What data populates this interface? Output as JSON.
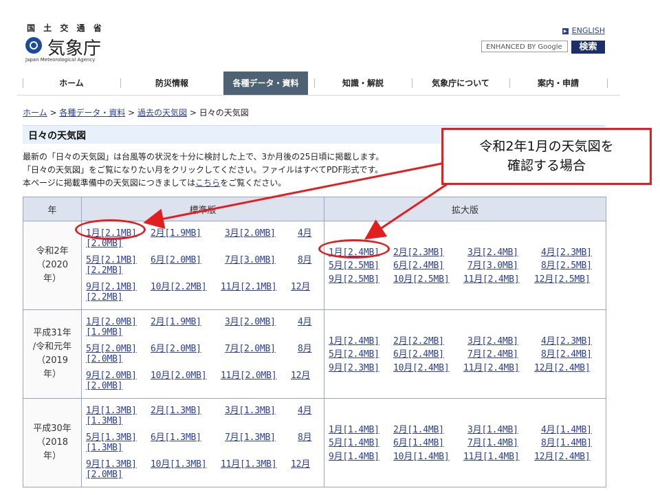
{
  "header": {
    "ministry": "国 土 交 通 省",
    "agency": "気象庁",
    "agency_en": "Japan Meteorological Agency",
    "english_link": "ENGLISH",
    "search_placeholder": "ENHANCED BY Google",
    "search_button": "検索"
  },
  "nav": [
    "ホーム",
    "防災情報",
    "各種データ・資料",
    "知識・解説",
    "気象庁について",
    "案内・申請"
  ],
  "breadcrumb": [
    "ホーム",
    "各種データ・資料",
    "過去の天気図",
    "日々の天気図"
  ],
  "page_title": "日々の天気図",
  "intro": [
    "最新の「日々の天気図」は台風等の状況を十分に検討した上で、3か月後の25日頃に掲載します。",
    "「日々の天気図」をご覧になりたい月をクリックしてください。ファイルはすべてPDF形式です。",
    "本ページに掲載準備中の天気図につきましては",
    "こちら",
    "をご覧ください。"
  ],
  "table": {
    "headers": [
      "年",
      "標準版",
      "拡大版"
    ],
    "rows": [
      {
        "year": [
          "令和2年",
          "（2020",
          "年）"
        ],
        "std": [
          "1月[2.1MB]",
          "2月[1.9MB]",
          "3月[2.0MB]",
          "4月",
          "[2.0MB]",
          "5月[2.1MB]",
          "6月[2.0MB]",
          "7月[3.0MB]",
          "8月",
          "[2.2MB]",
          "9月[2.1MB]",
          "10月[2.2MB]",
          "11月[2.1MB]",
          "12月",
          "[2.2MB]"
        ],
        "ext": [
          "1月[2.4MB]",
          "2月[2.3MB]",
          "3月[2.4MB]",
          "4月[2.3MB]",
          "5月[2.5MB]",
          "6月[2.4MB]",
          "7月[3.0MB]",
          "8月[2.5MB]",
          "9月[2.5MB]",
          "10月[2.5MB]",
          "11月[2.4MB]",
          "12月[2.5MB]"
        ]
      },
      {
        "year": [
          "平成31年",
          "/令和元年",
          "（2019",
          "年）"
        ],
        "std": [
          "1月[2.0MB]",
          "2月[1.9MB]",
          "3月[2.0MB]",
          "4月",
          "[1.9MB]",
          "5月[2.0MB]",
          "6月[2.0MB]",
          "7月[2.0MB]",
          "8月",
          "[2.0MB]",
          "9月[2.0MB]",
          "10月[2.0MB]",
          "11月[2.0MB]",
          "12月",
          "[2.0MB]"
        ],
        "ext": [
          "1月[2.4MB]",
          "2月[2.2MB]",
          "3月[2.4MB]",
          "4月[2.3MB]",
          "5月[2.4MB]",
          "6月[2.4MB]",
          "7月[2.4MB]",
          "8月[2.4MB]",
          "9月[2.3MB]",
          "10月[2.4MB]",
          "11月[2.4MB]",
          "12月[2.4MB]"
        ]
      },
      {
        "year": [
          "平成30年",
          "（2018",
          "年）"
        ],
        "std": [
          "1月[1.3MB]",
          "2月[1.3MB]",
          "3月[1.3MB]",
          "4月",
          "[1.3MB]",
          "5月[1.3MB]",
          "6月[1.3MB]",
          "7月[1.3MB]",
          "8月",
          "[1.3MB]",
          "9月[1.3MB]",
          "10月[1.3MB]",
          "11月[1.3MB]",
          "12月",
          "[2.0MB]"
        ],
        "ext": [
          "1月[1.4MB]",
          "2月[1.4MB]",
          "3月[1.4MB]",
          "4月[1.4MB]",
          "5月[1.4MB]",
          "6月[1.4MB]",
          "7月[1.4MB]",
          "8月[1.4MB]",
          "9月[1.4MB]",
          "10月[1.4MB]",
          "11月[1.4MB]",
          "12月[2.4MB]"
        ]
      }
    ]
  },
  "annotation": {
    "callout_line1": "令和2年1月の天気図を",
    "callout_line2": "確認する場合",
    "color": "#e11f1f"
  }
}
